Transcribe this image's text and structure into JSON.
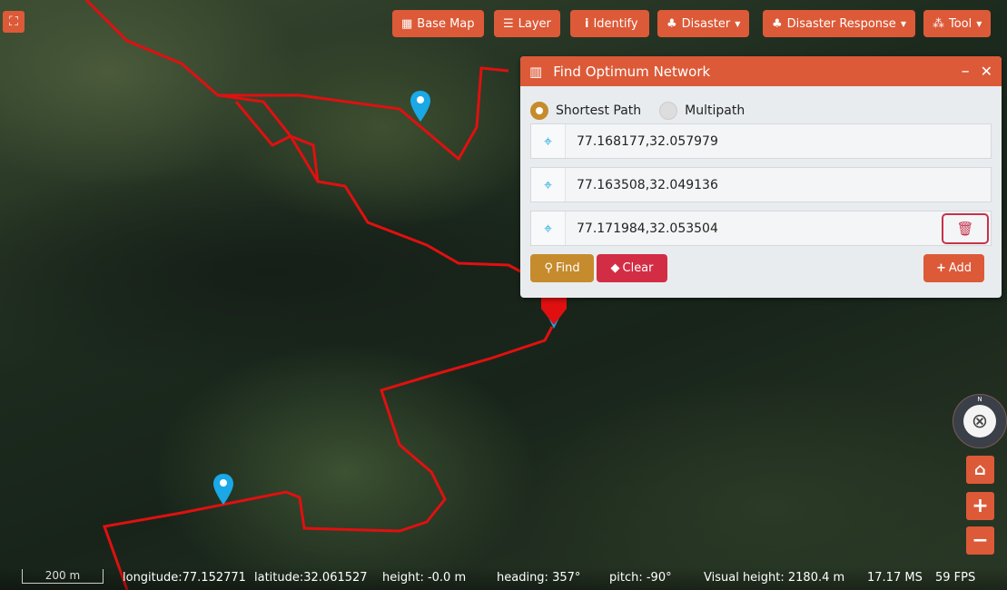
{
  "toolbar": {
    "fullscreen_icon": "expand-icon",
    "buttons": [
      {
        "label": "Base Map",
        "icon": "map-icon"
      },
      {
        "label": "Layer",
        "icon": "list-icon"
      },
      {
        "label": "Identify",
        "icon": "info-icon"
      },
      {
        "label": "Disaster",
        "icon": "tree-icon",
        "dropdown": true
      },
      {
        "label": "Disaster Response",
        "icon": "tree-icon",
        "dropdown": true
      },
      {
        "label": "Tool",
        "icon": "cubes-icon",
        "dropdown": true
      }
    ]
  },
  "panel": {
    "title": "Find Optimum Network",
    "icon": "building-icon",
    "radios": [
      {
        "label": "Shortest Path",
        "selected": true
      },
      {
        "label": "Multipath",
        "selected": false
      }
    ],
    "points": [
      "77.168177,32.057979",
      "77.163508,32.049136",
      "77.171984,32.053504"
    ],
    "find_label": "Find",
    "clear_label": "Clear",
    "add_label": "Add"
  },
  "status": {
    "scale": "200 m",
    "longitude": "longitude:77.152771",
    "latitude": "latitude:32.061527",
    "height": "height: -0.0 m",
    "heading": "heading: 357°",
    "pitch": "pitch: -90°",
    "visual_height": "Visual height: 2180.4 m",
    "ms": "17.17 MS",
    "fps": "59 FPS"
  },
  "compass": {
    "north": "N"
  },
  "colors": {
    "accent": "#dc5a38",
    "find": "#c68b2c",
    "clear": "#d22d45",
    "route": "#e01010",
    "marker": "#1aa8e6"
  }
}
